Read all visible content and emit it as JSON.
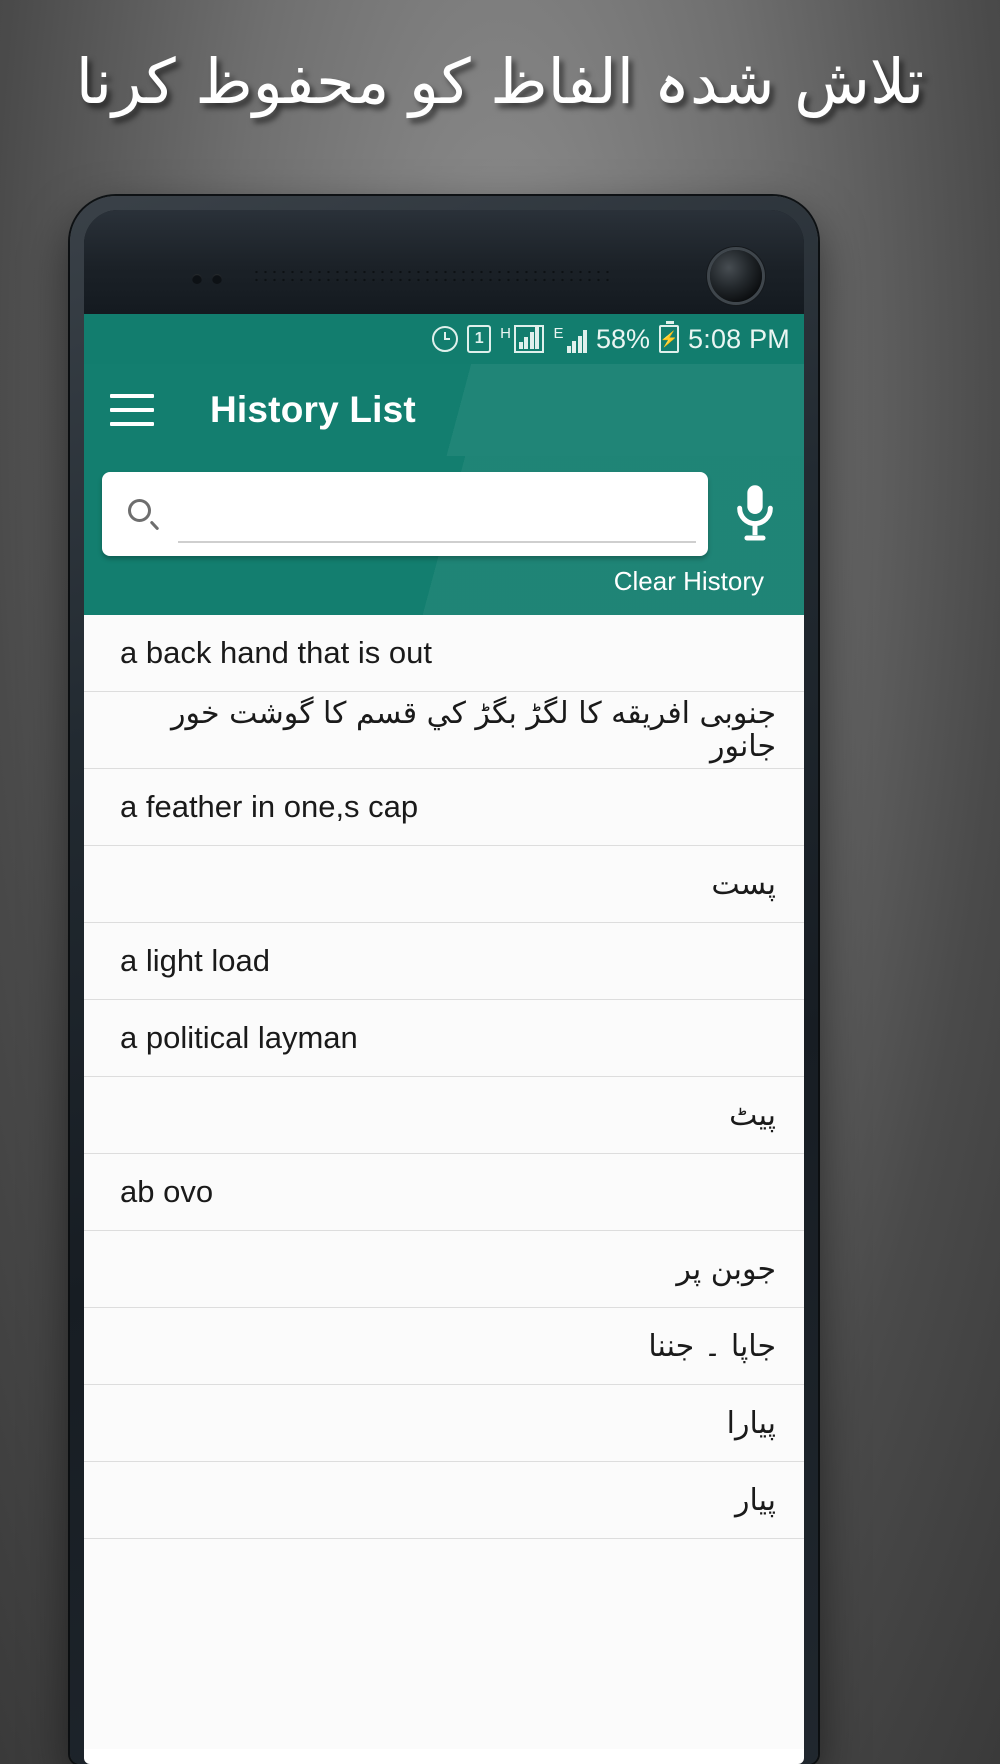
{
  "promo": {
    "headline": "تلاش شدہ الفاظ کو محفوظ کرنا"
  },
  "statusbar": {
    "alarm_icon": "alarm-clock-icon",
    "sim_label": "1",
    "network_1_label": "H",
    "network_2_label": "E",
    "battery_percent": "58%",
    "battery_icon": "battery-charging-icon",
    "time": "5:08 PM"
  },
  "appbar": {
    "menu_icon": "hamburger-menu-icon",
    "title": "History List"
  },
  "search": {
    "search_icon": "search-icon",
    "value": "",
    "placeholder": "",
    "mic_icon": "microphone-icon",
    "clear_history_label": "Clear History"
  },
  "history": {
    "items": [
      {
        "text": "a back hand that is out",
        "dir": "ltr"
      },
      {
        "text": "جنوبی افریقه کا لگڑ بگڑ کي قسم کا گوشت خور جانور",
        "dir": "rtl"
      },
      {
        "text": "a feather in one,s cap",
        "dir": "ltr"
      },
      {
        "text": "پست",
        "dir": "rtl"
      },
      {
        "text": "a light load",
        "dir": "ltr"
      },
      {
        "text": "a political layman",
        "dir": "ltr"
      },
      {
        "text": "پیٹ",
        "dir": "rtl"
      },
      {
        "text": "ab ovo",
        "dir": "ltr"
      },
      {
        "text": "جوبن پر",
        "dir": "rtl"
      },
      {
        "text": "جاپا ۔ جننا",
        "dir": "rtl"
      },
      {
        "text": "پیارا",
        "dir": "rtl"
      },
      {
        "text": "پیار",
        "dir": "rtl"
      }
    ]
  },
  "theme": {
    "accent": "#137e6f",
    "statusbar_bg": "#127d6e",
    "list_bg": "#fbfbfb",
    "text_primary": "#1a1a1a"
  }
}
